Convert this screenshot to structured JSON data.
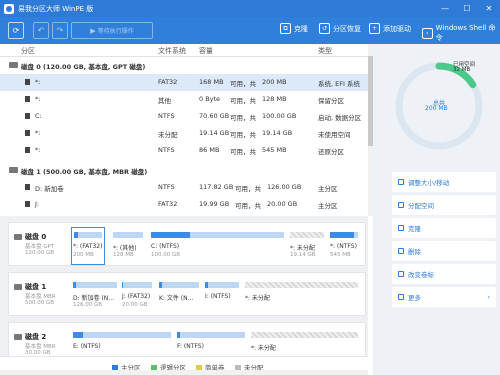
{
  "app": {
    "title": "易我分区大师 WinPE 版"
  },
  "window_controls": [
    "—",
    "☐",
    "✕"
  ],
  "toolbar": {
    "refresh": "⟳",
    "undo": "↶",
    "redo": "↷",
    "pending": "等待执行操作",
    "clone": "克隆",
    "recover": "分区恢复",
    "add_driver": "添加驱动",
    "shell": "Windows Shell 命令"
  },
  "table": {
    "headers": [
      "分区",
      "文件系统",
      "容量",
      "类型"
    ],
    "rows": [
      {
        "kind": "disk",
        "name": "磁盘 0 (120.00 GB, 基本盘, GPT 磁盘)"
      },
      {
        "kind": "part",
        "name": "*:",
        "fs": "FAT32",
        "used": "168 MB",
        "free_label": "可用，共",
        "total": "200 MB",
        "type": "系统, EFI 系统"
      },
      {
        "kind": "part",
        "name": "*:",
        "fs": "其他",
        "used": "0 Byte",
        "free_label": "可用，共",
        "total": "128 MB",
        "type": "保留分区"
      },
      {
        "kind": "part",
        "name": "C:",
        "fs": "NTFS",
        "used": "70.60 GB",
        "free_label": "可用，共",
        "total": "100.00 GB",
        "type": "启动, 数据分区"
      },
      {
        "kind": "part",
        "name": "*:",
        "fs": "未分配",
        "used": "19.14 GB",
        "free_label": "可用，共",
        "total": "19.14 GB",
        "type": "未使用空间"
      },
      {
        "kind": "part",
        "name": "*:",
        "fs": "NTFS",
        "used": "86 MB",
        "free_label": "可用，共",
        "total": "545 MB",
        "type": "还原分区"
      },
      {
        "kind": "disk",
        "name": "磁盘 1 (500.00 GB, 基本盘, MBR 磁盘)"
      },
      {
        "kind": "part",
        "name": "D: 新加卷",
        "fs": "NTFS",
        "used": "117.82 GB",
        "free_label": "可用，共",
        "total": "126.00 GB",
        "type": "主分区"
      },
      {
        "kind": "part",
        "name": "J:",
        "fs": "FAT32",
        "used": "19.99 GB",
        "free_label": "可用，共",
        "total": "20.00 GB",
        "type": "主分区"
      },
      {
        "kind": "part",
        "name": "K:",
        "fs": "NTFS",
        "used": "",
        "free_label": "",
        "total": "",
        "type": ""
      }
    ]
  },
  "diskmap": [
    {
      "label": "磁盘 0",
      "sub1": "基本盘 GPT",
      "sub2": "120.00 GB",
      "parts": [
        {
          "name": "*: (FAT32)",
          "size": "200 MB",
          "used": 0.16
        },
        {
          "name": "*: (其他)",
          "size": "128 MB",
          "used": 0
        },
        {
          "name": "C: (NTFS)",
          "size": "100.00 GB",
          "used": 0.29
        },
        {
          "name": "*: 未分配",
          "size": "19.14 GB",
          "used": 0
        },
        {
          "name": "*: (NTFS)",
          "size": "545 MB",
          "used": 0.84
        }
      ]
    },
    {
      "label": "磁盘 1",
      "sub1": "基本盘 MBR",
      "sub2": "500.00 GB",
      "parts": [
        {
          "name": "D: 新加卷 (N...",
          "size": "126.00 GB",
          "used": 0.06
        },
        {
          "name": "J: (FAT32)",
          "size": "20.00 GB",
          "used": 0.01
        },
        {
          "name": "K: 文件 (N...",
          "size": "",
          "used": 0.08
        },
        {
          "name": "I: (NTFS)",
          "size": "",
          "used": 0.08
        },
        {
          "name": "*: 未分配",
          "size": "",
          "used": 0
        }
      ]
    },
    {
      "label": "磁盘 2",
      "sub1": "基本盘 MBR",
      "sub2": "30.00 GB",
      "parts": [
        {
          "name": "E: (NTFS)",
          "size": "",
          "used": 0.1
        },
        {
          "name": "F: (NTFS)",
          "size": "",
          "used": 0.05
        },
        {
          "name": "*: 未分配",
          "size": "",
          "used": 0
        }
      ]
    }
  ],
  "legend": [
    "主分区",
    "逻辑分区",
    "简单卷",
    "未分配"
  ],
  "colors": {
    "primary": "#2d7bd6",
    "logical": "#5bbf6b",
    "simple": "#e6c84a",
    "unallocated": "#b9b9b9"
  },
  "donut": {
    "used_label": "已用空间",
    "used_value": "32 MB",
    "total_label": "总共",
    "total_value": "200 MB",
    "used_fraction": 0.16
  },
  "actions": [
    "调整大小/移动",
    "分配空间",
    "克隆",
    "删除",
    "改变卷标",
    "更多"
  ]
}
